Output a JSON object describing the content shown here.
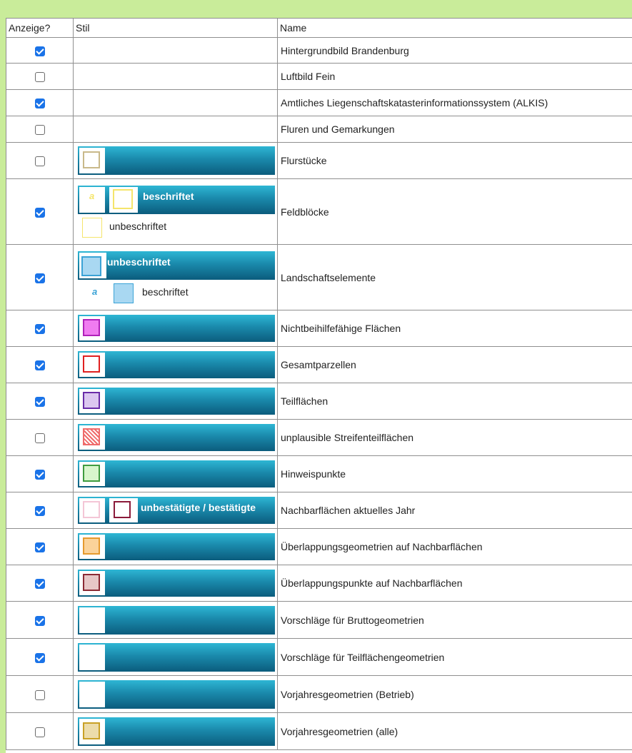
{
  "headers": {
    "show": "Anzeige?",
    "style": "Stil",
    "name": "Name"
  },
  "rows": [
    {
      "name": "Hintergrundbild Brandenburg",
      "checked": true
    },
    {
      "name": "Luftbild Fein",
      "checked": false
    },
    {
      "name": "Amtliches Liegenschaftskatasterinformationssystem (ALKIS)",
      "checked": true
    },
    {
      "name": "Fluren und Gemarkungen",
      "checked": false
    },
    {
      "name": "Flurstücke",
      "checked": false
    },
    {
      "name": "Feldblöcke",
      "checked": true
    },
    {
      "name": "Landschaftselemente",
      "checked": true
    },
    {
      "name": "Nichtbeihilfefähige Flächen",
      "checked": true
    },
    {
      "name": "Gesamtparzellen",
      "checked": true
    },
    {
      "name": "Teilflächen",
      "checked": true
    },
    {
      "name": "unplausible Streifenteilflächen",
      "checked": false
    },
    {
      "name": "Hinweispunkte",
      "checked": true
    },
    {
      "name": "Nachbarflächen aktuelles Jahr",
      "checked": true
    },
    {
      "name": "Überlappungsgeometrien auf Nachbarflächen",
      "checked": true
    },
    {
      "name": "Überlappungspunkte auf Nachbarflächen",
      "checked": true
    },
    {
      "name": "Vorschläge für Bruttogeometrien",
      "checked": true
    },
    {
      "name": "Vorschläge für Teilflächengeometrien",
      "checked": true
    },
    {
      "name": "Vorjahresgeometrien (Betrieb)",
      "checked": false
    },
    {
      "name": "Vorjahresgeometrien (alle)",
      "checked": false
    }
  ],
  "legend": {
    "feldbloecke_labeled": "beschriftet",
    "feldbloecke_unlabeled": "unbeschriftet",
    "landschaft_unlabeled": "unbeschriftet",
    "landschaft_labeled": "beschriftet",
    "label_marker": "a",
    "nachbar_label": "unbestätigte / bestätigte"
  },
  "colors": {
    "flurstuecke": "#c9b98a",
    "feldbloecke": "#f5e56b",
    "landschaft_border": "#3ba3d6",
    "landschaft_fill": "#a9d8f2",
    "nichtbeihilfe_border": "#b021b9",
    "nichtbeihilfe_fill": "#f07cf0",
    "gesamtparzellen": "#e02020",
    "teilflaechen_border": "#6a2ca8",
    "teilflaechen_fill": "#dcc7f0",
    "unplausibel": "#ef6b6b",
    "hinweis_border": "#3f9b3f",
    "hinweis_fill": "#d8f6cc",
    "nachbar_unconfirmed": "#f4c6d6",
    "nachbar_confirmed": "#8b1a3a",
    "ueberlappung_geo_border": "#e69a2e",
    "ueberlappung_geo_fill": "#fbd39a",
    "ueberlappung_pkt_border": "#8b2a34",
    "ueberlappung_pkt_fill": "#e7c7c7",
    "vorjahr_alle_border": "#c9a126",
    "vorjahr_alle_fill": "#ecdcab"
  }
}
